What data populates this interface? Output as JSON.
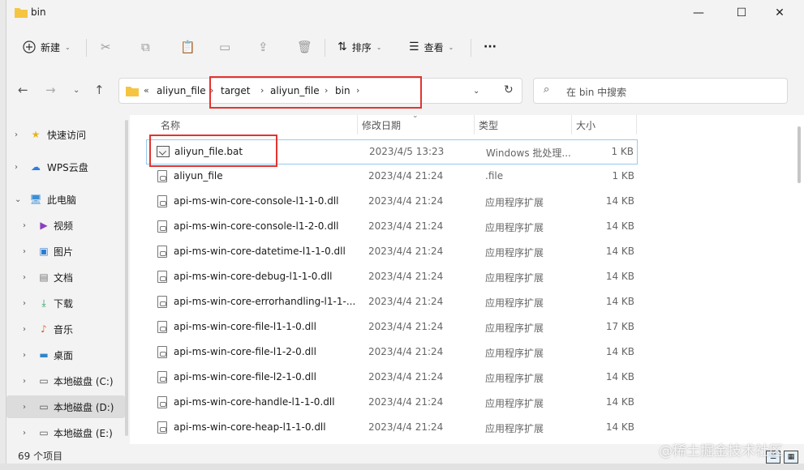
{
  "window": {
    "title": "bin",
    "controls": {
      "minimize": "—",
      "maximize": "☐",
      "close": "✕"
    }
  },
  "toolbar": {
    "new_label": "新建",
    "sort_label": "排序",
    "view_label": "查看",
    "more_label": "···"
  },
  "address": {
    "overflow": "«",
    "crumbs": [
      "aliyun_file",
      "target",
      "aliyun_file",
      "bin"
    ],
    "search_placeholder": "在 bin 中搜索"
  },
  "nav": {
    "items": [
      {
        "label": "快速访问",
        "icon": "star-icon"
      },
      {
        "label": "WPS云盘",
        "icon": "cloud-icon"
      },
      {
        "label": "此电脑",
        "icon": "computer-icon"
      },
      {
        "label": "视频",
        "icon": "video-icon"
      },
      {
        "label": "图片",
        "icon": "picture-icon"
      },
      {
        "label": "文档",
        "icon": "document-icon"
      },
      {
        "label": "下载",
        "icon": "download-icon"
      },
      {
        "label": "音乐",
        "icon": "music-icon"
      },
      {
        "label": "桌面",
        "icon": "desktop-icon"
      },
      {
        "label": "本地磁盘 (C:)",
        "icon": "drive-icon"
      },
      {
        "label": "本地磁盘 (D:)",
        "icon": "drive-icon"
      },
      {
        "label": "本地磁盘 (E:)",
        "icon": "drive-icon"
      }
    ]
  },
  "columns": {
    "name": "名称",
    "modified": "修改日期",
    "type": "类型",
    "size": "大小"
  },
  "files": [
    {
      "name": "aliyun_file.bat",
      "modified": "2023/4/5 13:23",
      "type": "Windows 批处理...",
      "size": "1 KB"
    },
    {
      "name": "aliyun_file",
      "modified": "2023/4/4 21:24",
      "type": ".file",
      "size": "1 KB"
    },
    {
      "name": "api-ms-win-core-console-l1-1-0.dll",
      "modified": "2023/4/4 21:24",
      "type": "应用程序扩展",
      "size": "14 KB"
    },
    {
      "name": "api-ms-win-core-console-l1-2-0.dll",
      "modified": "2023/4/4 21:24",
      "type": "应用程序扩展",
      "size": "14 KB"
    },
    {
      "name": "api-ms-win-core-datetime-l1-1-0.dll",
      "modified": "2023/4/4 21:24",
      "type": "应用程序扩展",
      "size": "14 KB"
    },
    {
      "name": "api-ms-win-core-debug-l1-1-0.dll",
      "modified": "2023/4/4 21:24",
      "type": "应用程序扩展",
      "size": "14 KB"
    },
    {
      "name": "api-ms-win-core-errorhandling-l1-1-...",
      "modified": "2023/4/4 21:24",
      "type": "应用程序扩展",
      "size": "14 KB"
    },
    {
      "name": "api-ms-win-core-file-l1-1-0.dll",
      "modified": "2023/4/4 21:24",
      "type": "应用程序扩展",
      "size": "17 KB"
    },
    {
      "name": "api-ms-win-core-file-l1-2-0.dll",
      "modified": "2023/4/4 21:24",
      "type": "应用程序扩展",
      "size": "14 KB"
    },
    {
      "name": "api-ms-win-core-file-l2-1-0.dll",
      "modified": "2023/4/4 21:24",
      "type": "应用程序扩展",
      "size": "14 KB"
    },
    {
      "name": "api-ms-win-core-handle-l1-1-0.dll",
      "modified": "2023/4/4 21:24",
      "type": "应用程序扩展",
      "size": "14 KB"
    },
    {
      "name": "api-ms-win-core-heap-l1-1-0.dll",
      "modified": "2023/4/4 21:24",
      "type": "应用程序扩展",
      "size": "14 KB"
    }
  ],
  "status": {
    "item_count": "69 个项目"
  },
  "watermark": "@稀土掘金技术社区",
  "colors": {
    "highlight": "#e3342f",
    "selection_border": "#99c9ef",
    "folder": "#f5c542"
  }
}
